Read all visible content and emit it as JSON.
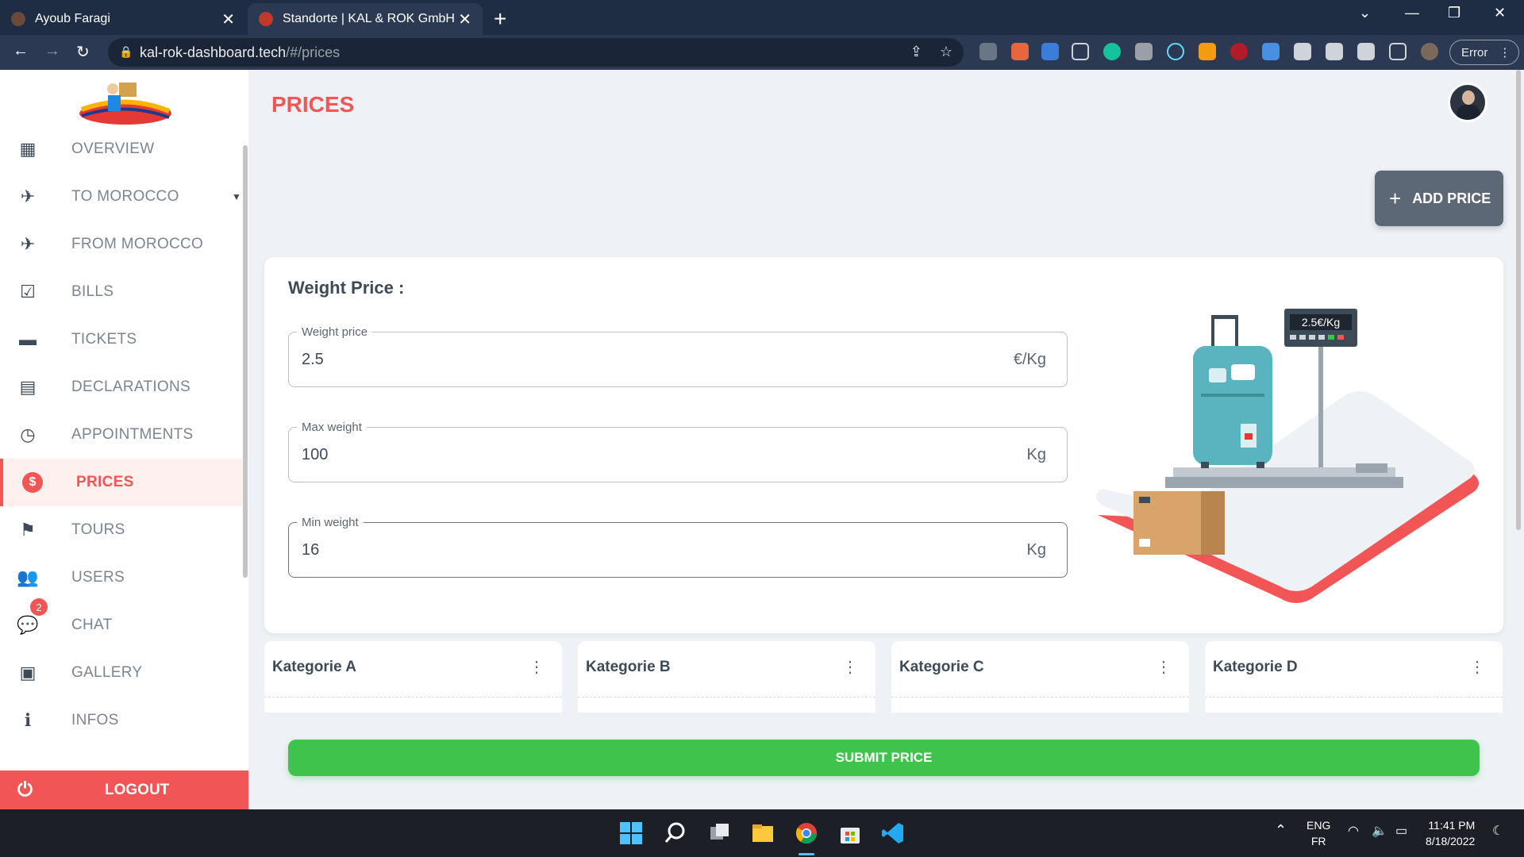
{
  "browser": {
    "tabs": [
      {
        "title": "Ayoub Faragi"
      },
      {
        "title": "Standorte | KAL & ROK GmbH"
      }
    ],
    "url_host": "kal-rok-dashboard.tech",
    "url_path": "/#/prices",
    "error_label": "Error"
  },
  "sidebar": {
    "items": [
      {
        "label": "OVERVIEW",
        "icon": "grid-icon"
      },
      {
        "label": "TO MOROCCO",
        "icon": "plane-takeoff-icon"
      },
      {
        "label": "FROM MOROCCO",
        "icon": "plane-landing-icon"
      },
      {
        "label": "BILLS",
        "icon": "clipboard-check-icon"
      },
      {
        "label": "TICKETS",
        "icon": "ticket-icon"
      },
      {
        "label": "DECLARATIONS",
        "icon": "document-icon"
      },
      {
        "label": "APPOINTMENTS",
        "icon": "bus-clock-icon"
      },
      {
        "label": "PRICES",
        "icon": "dollar-icon"
      },
      {
        "label": "TOURS",
        "icon": "flag-icon"
      },
      {
        "label": "USERS",
        "icon": "users-icon"
      },
      {
        "label": "CHAT",
        "icon": "chat-icon",
        "badge": "2"
      },
      {
        "label": "GALLERY",
        "icon": "gallery-icon"
      },
      {
        "label": "INFOS",
        "icon": "info-icon"
      }
    ],
    "logout_label": "LOGOUT"
  },
  "main": {
    "title": "PRICES",
    "add_button": "ADD PRICE",
    "card_title": "Weight Price :",
    "fields": [
      {
        "label": "Weight price",
        "value": "2.5",
        "unit": "€/Kg"
      },
      {
        "label": "Max weight",
        "value": "100",
        "unit": "Kg"
      },
      {
        "label": "Min weight",
        "value": "16",
        "unit": "Kg"
      }
    ],
    "scale_display": "2.5€/Kg",
    "submit_label": "SUBMIT PRICE",
    "categories": [
      "Kategorie A",
      "Kategorie B",
      "Kategorie C",
      "Kategorie D"
    ]
  },
  "taskbar": {
    "lang_top": "ENG",
    "lang_bottom": "FR",
    "time": "11:41 PM",
    "date": "8/18/2022"
  },
  "colors": {
    "accent": "#f25555",
    "submit": "#3fc34c",
    "chrome": "#2b3a52"
  }
}
